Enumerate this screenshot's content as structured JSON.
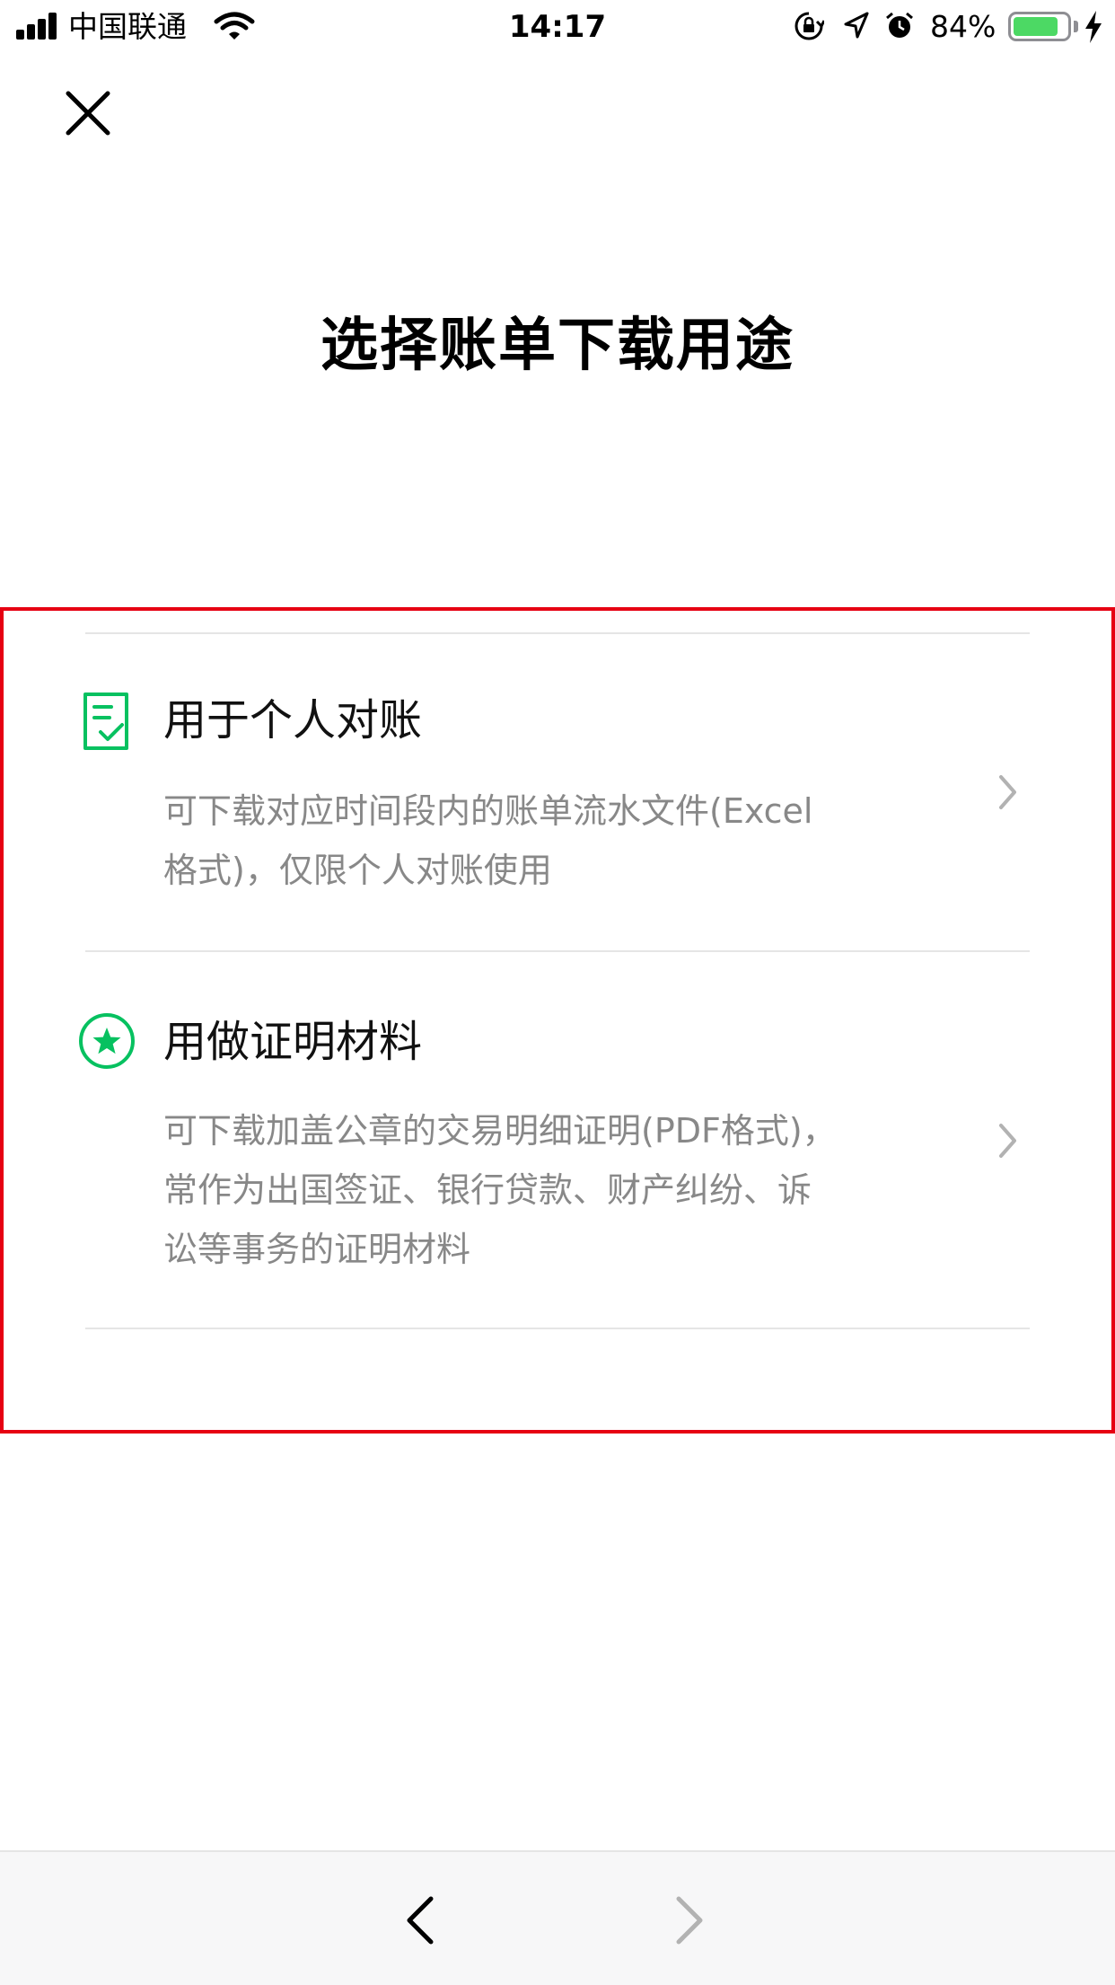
{
  "status_bar": {
    "carrier": "中国联通",
    "time": "14:17",
    "battery": "84%",
    "battery_level": 0.84,
    "icons": [
      "signal-icon",
      "wifi-icon",
      "rotation-lock-icon",
      "location-icon",
      "alarm-icon",
      "battery-icon",
      "charging-icon"
    ]
  },
  "header": {
    "close_icon": "close-icon",
    "title": "选择账单下载用途"
  },
  "options": [
    {
      "icon": "document-check-icon",
      "title": "用于个人对账",
      "desc_lines": [
        "可下载对应时间段内的账单流水文件(Excel",
        "格式)，仅限个人对账使用"
      ]
    },
    {
      "icon": "star-circle-icon",
      "title": "用做证明材料",
      "desc_lines": [
        "可下载加盖公章的交易明细证明(PDF格式)，",
        "常作为出国签证、银行贷款、财产纠纷、诉",
        "讼等事务的证明材料"
      ]
    }
  ],
  "colors": {
    "accent": "#07c160",
    "highlight_border": "#e60012",
    "secondary_text": "#888888"
  },
  "bottom_nav": {
    "back_icon": "chevron-left-icon",
    "forward_icon": "chevron-right-icon"
  }
}
